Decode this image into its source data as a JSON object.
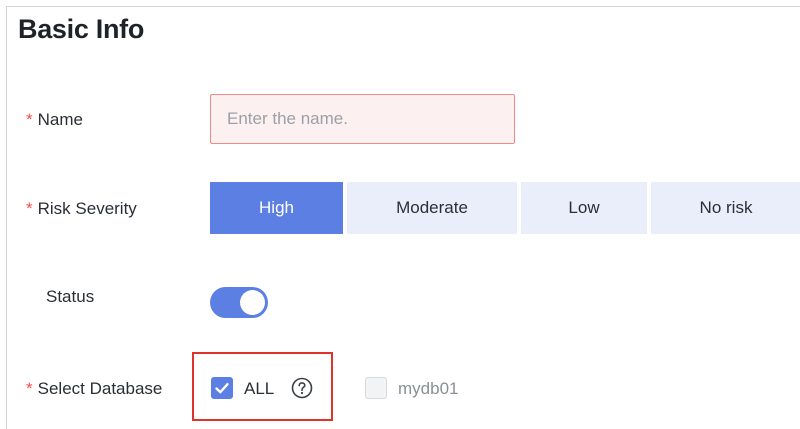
{
  "section": {
    "title": "Basic Info"
  },
  "form": {
    "name": {
      "label": "Name",
      "required": true,
      "placeholder": "Enter the name.",
      "value": ""
    },
    "risk_severity": {
      "label": "Risk Severity",
      "required": true,
      "options": [
        "High",
        "Moderate",
        "Low",
        "No risk"
      ],
      "selected": "High"
    },
    "status": {
      "label": "Status",
      "enabled": true
    },
    "select_database": {
      "label": "Select Database",
      "required": true,
      "all_label": "ALL",
      "all_checked": true,
      "databases": [
        {
          "label": "mydb01",
          "checked": false,
          "disabled": true
        }
      ]
    }
  },
  "icons": {
    "required_marker": "*",
    "all_help": "help-circle-icon",
    "checkbox_checked": "check-icon"
  },
  "colors": {
    "accent": "#5b7fe3",
    "error_border": "#f48a88",
    "error_bg": "#fdf0f0",
    "required": "#f0504a",
    "highlight_border": "#e0322b",
    "segment_bg": "#e9eefa"
  }
}
